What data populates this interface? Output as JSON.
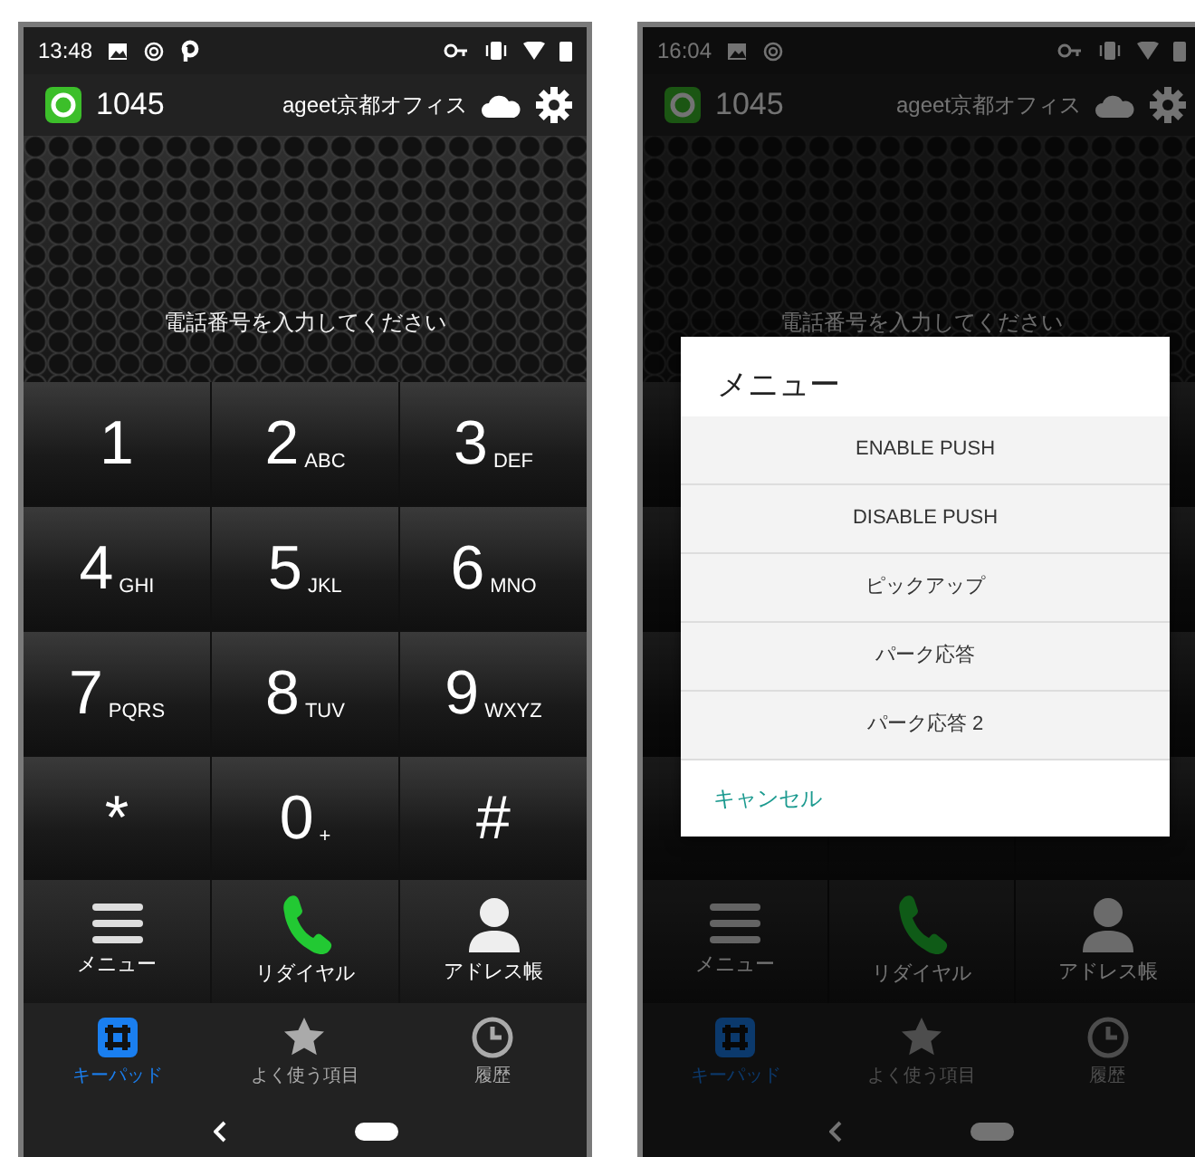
{
  "screens": [
    {
      "dimmed": false,
      "status_bar": {
        "time": "13:48",
        "notifications": [
          {
            "kind": "image"
          },
          {
            "kind": "sync"
          },
          {
            "kind": "parking"
          }
        ]
      },
      "header": {
        "extension": "1045",
        "account": "ageet京都オフィス"
      },
      "prompt": "電話番号を入力してください",
      "keys": [
        {
          "digit": "1"
        },
        {
          "digit": "2",
          "letters": "ABC"
        },
        {
          "digit": "3",
          "letters": "DEF"
        },
        {
          "digit": "4",
          "letters": "GHI"
        },
        {
          "digit": "5",
          "letters": "JKL"
        },
        {
          "digit": "6",
          "letters": "MNO"
        },
        {
          "digit": "7",
          "letters": "PQRS"
        },
        {
          "digit": "8",
          "letters": "TUV"
        },
        {
          "digit": "9",
          "letters": "WXYZ"
        },
        {
          "digit": "*"
        },
        {
          "digit": "0",
          "letters": "+"
        },
        {
          "digit": "#"
        }
      ],
      "actions": [
        {
          "kind": "menu",
          "label": "メニュー"
        },
        {
          "kind": "redial",
          "label": "リダイヤル"
        },
        {
          "kind": "contacts",
          "label": "アドレス帳"
        }
      ],
      "tabs": [
        {
          "kind": "keypad",
          "label": "キーパッド",
          "selected": true
        },
        {
          "kind": "favorites",
          "label": "よく使う項目",
          "selected": false
        },
        {
          "kind": "history",
          "label": "履歴",
          "selected": false
        }
      ]
    },
    {
      "dimmed": true,
      "status_bar": {
        "time": "16:04",
        "notifications": [
          {
            "kind": "image"
          },
          {
            "kind": "sync"
          }
        ]
      },
      "header": {
        "extension": "1045",
        "account": "ageet京都オフィス"
      },
      "prompt": "電話番号を入力してください",
      "actions": [
        {
          "kind": "menu",
          "label": "メニュー"
        },
        {
          "kind": "redial",
          "label": "リダイヤル"
        },
        {
          "kind": "contacts",
          "label": "アドレス帳"
        }
      ],
      "tabs": [
        {
          "kind": "keypad",
          "label": "キーパッド",
          "selected": true
        },
        {
          "kind": "favorites",
          "label": "よく使う項目",
          "selected": false
        },
        {
          "kind": "history",
          "label": "履歴",
          "selected": false
        }
      ],
      "dialog": {
        "title": "メニュー",
        "items": [
          "ENABLE PUSH",
          "DISABLE PUSH",
          "ピックアップ",
          "パーク応答",
          "パーク応答 2"
        ],
        "cancel": "キャンセル"
      }
    }
  ]
}
